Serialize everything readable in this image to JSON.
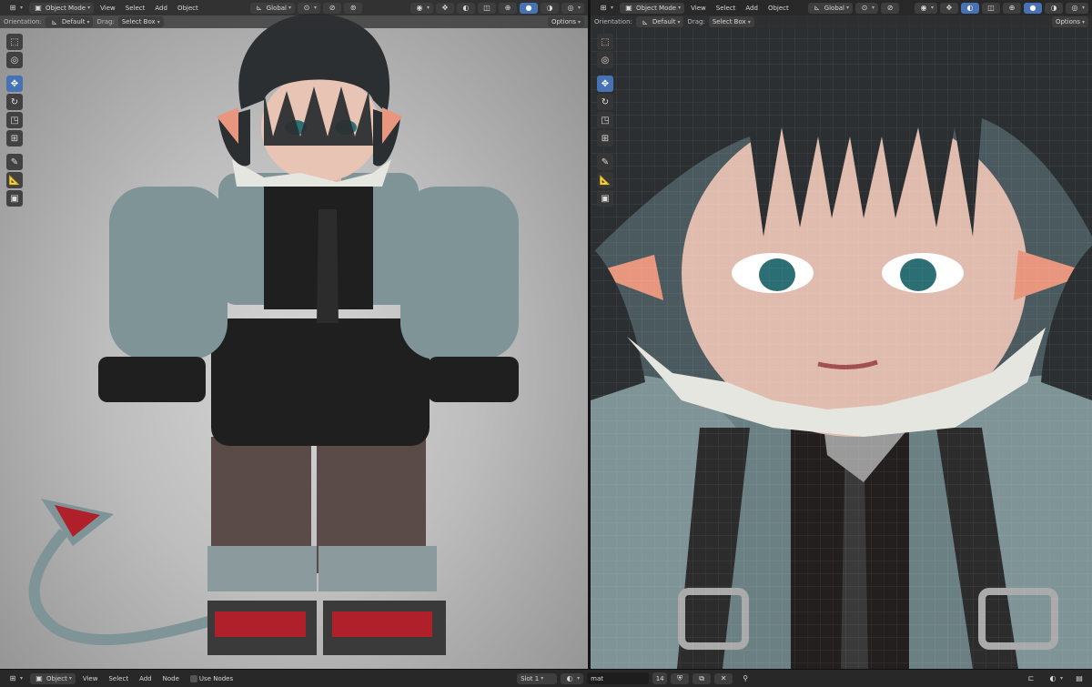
{
  "left_view": {
    "header": {
      "mode": "Object Mode",
      "menus": [
        "View",
        "Select",
        "Add",
        "Object"
      ],
      "transform": "Global"
    },
    "subheader": {
      "orientation_label": "Orientation:",
      "orientation_value": "Default",
      "drag_label": "Drag:",
      "drag_value": "Select Box",
      "options": "Options"
    }
  },
  "right_view": {
    "header": {
      "mode": "Object Mode",
      "menus": [
        "View",
        "Select",
        "Add",
        "Object"
      ],
      "transform": "Global"
    },
    "subheader": {
      "orientation_label": "Orientation:",
      "orientation_value": "Default",
      "drag_label": "Drag:",
      "drag_value": "Select Box",
      "options": "Options"
    }
  },
  "toolbar_icons": [
    "select-box-icon",
    "cursor-icon",
    "move-icon",
    "rotate-icon",
    "scale-icon",
    "transform-icon",
    "annotate-icon",
    "measure-icon",
    "add-cube-icon"
  ],
  "node_editor_footer": {
    "mode": "Object",
    "menus": [
      "View",
      "Select",
      "Add",
      "Node"
    ],
    "use_nodes_label": "Use Nodes",
    "slot": "Slot 1",
    "material": "mat",
    "user_count": "14"
  },
  "colors": {
    "accent": "#4772b3",
    "header_bg": "#282828"
  }
}
